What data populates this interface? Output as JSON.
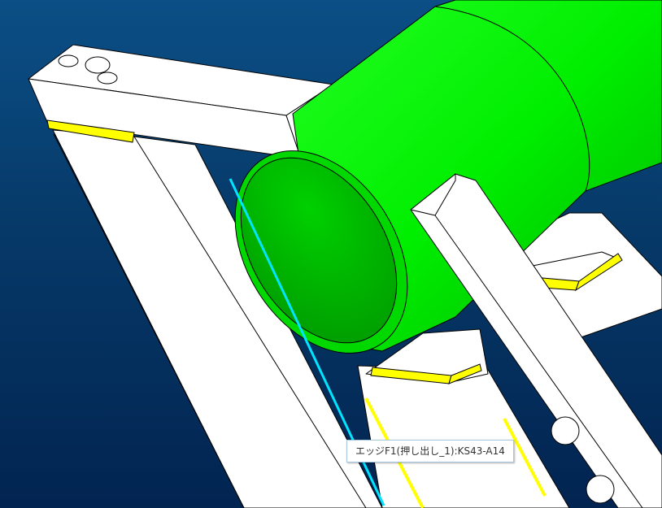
{
  "viewport": {
    "background_top": "#0b4f86",
    "background_bottom": "#022451",
    "part_color": "#00ff00",
    "highlight_edge_color": "#00e5ff",
    "face_accent_color": "#ffff00"
  },
  "tooltip": {
    "text": "エッジF1(押し出し_1):KS43-A14"
  }
}
